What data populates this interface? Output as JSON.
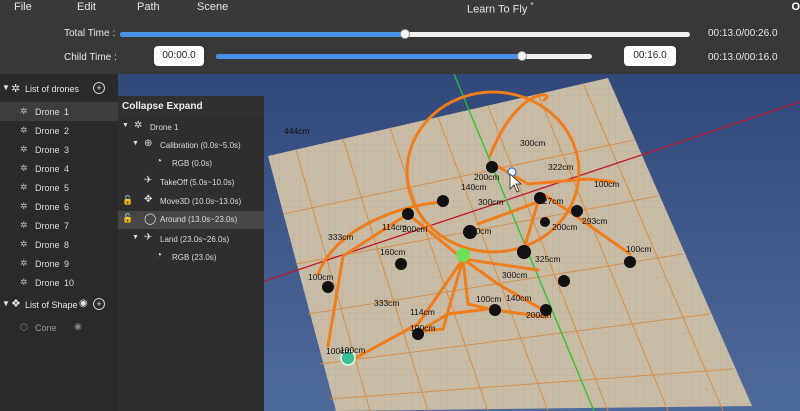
{
  "menu": {
    "file": "File",
    "edit": "Edit",
    "path": "Path",
    "scene": "Scene",
    "title": "Learn To Fly",
    "modified_mark": "*",
    "edge_letter": "O"
  },
  "timeline": {
    "total_label": "Total Time :",
    "child_label": "Child Time :",
    "total_progress": 0.5,
    "child_progress": 0.8125,
    "child_start": "00:00.0",
    "child_end": "00:16.0",
    "total_readout": "00:13.0/00:26.0",
    "child_readout": "00:13.0/00:16.0"
  },
  "sidebar": {
    "drones_title": "List of drones",
    "drones": [
      {
        "name": "Drone",
        "num": "1"
      },
      {
        "name": "Drone",
        "num": "2"
      },
      {
        "name": "Drone",
        "num": "3"
      },
      {
        "name": "Drone",
        "num": "4"
      },
      {
        "name": "Drone",
        "num": "5"
      },
      {
        "name": "Drone",
        "num": "6"
      },
      {
        "name": "Drone",
        "num": "7"
      },
      {
        "name": "Drone",
        "num": "8"
      },
      {
        "name": "Drone",
        "num": "9"
      },
      {
        "name": "Drone",
        "num": "10"
      }
    ],
    "shape_title": "List of Shape",
    "shapes": [
      {
        "name": "Cone"
      }
    ]
  },
  "tree": {
    "header": "Collapse Expand",
    "drone": "Drone 1",
    "calibration": "Calibration (0.0s~5.0s)",
    "rgb1": "RGB (0.0s)",
    "takeoff": "TakeOff (5.0s~10.0s)",
    "move3d": "Move3D (10.0s~13.0s)",
    "around": "Around (13.0s~23.0s)",
    "land": "Land (23.0s~26.0s)",
    "rgb2": "RGB (23.0s)"
  },
  "scene": {
    "labels": [
      "444cm",
      "300cm",
      "322cm",
      "200cm",
      "140cm",
      "100cm",
      "300cm",
      "127cm",
      "333cm",
      "114cm",
      "200cm",
      "300cm",
      "293cm",
      "200cm",
      "160cm",
      "100cm",
      "325cm",
      "100cm",
      "300cm",
      "100cm",
      "140cm",
      "333cm",
      "100cm",
      "200cm",
      "114cm",
      "100cm",
      "100cm"
    ]
  }
}
